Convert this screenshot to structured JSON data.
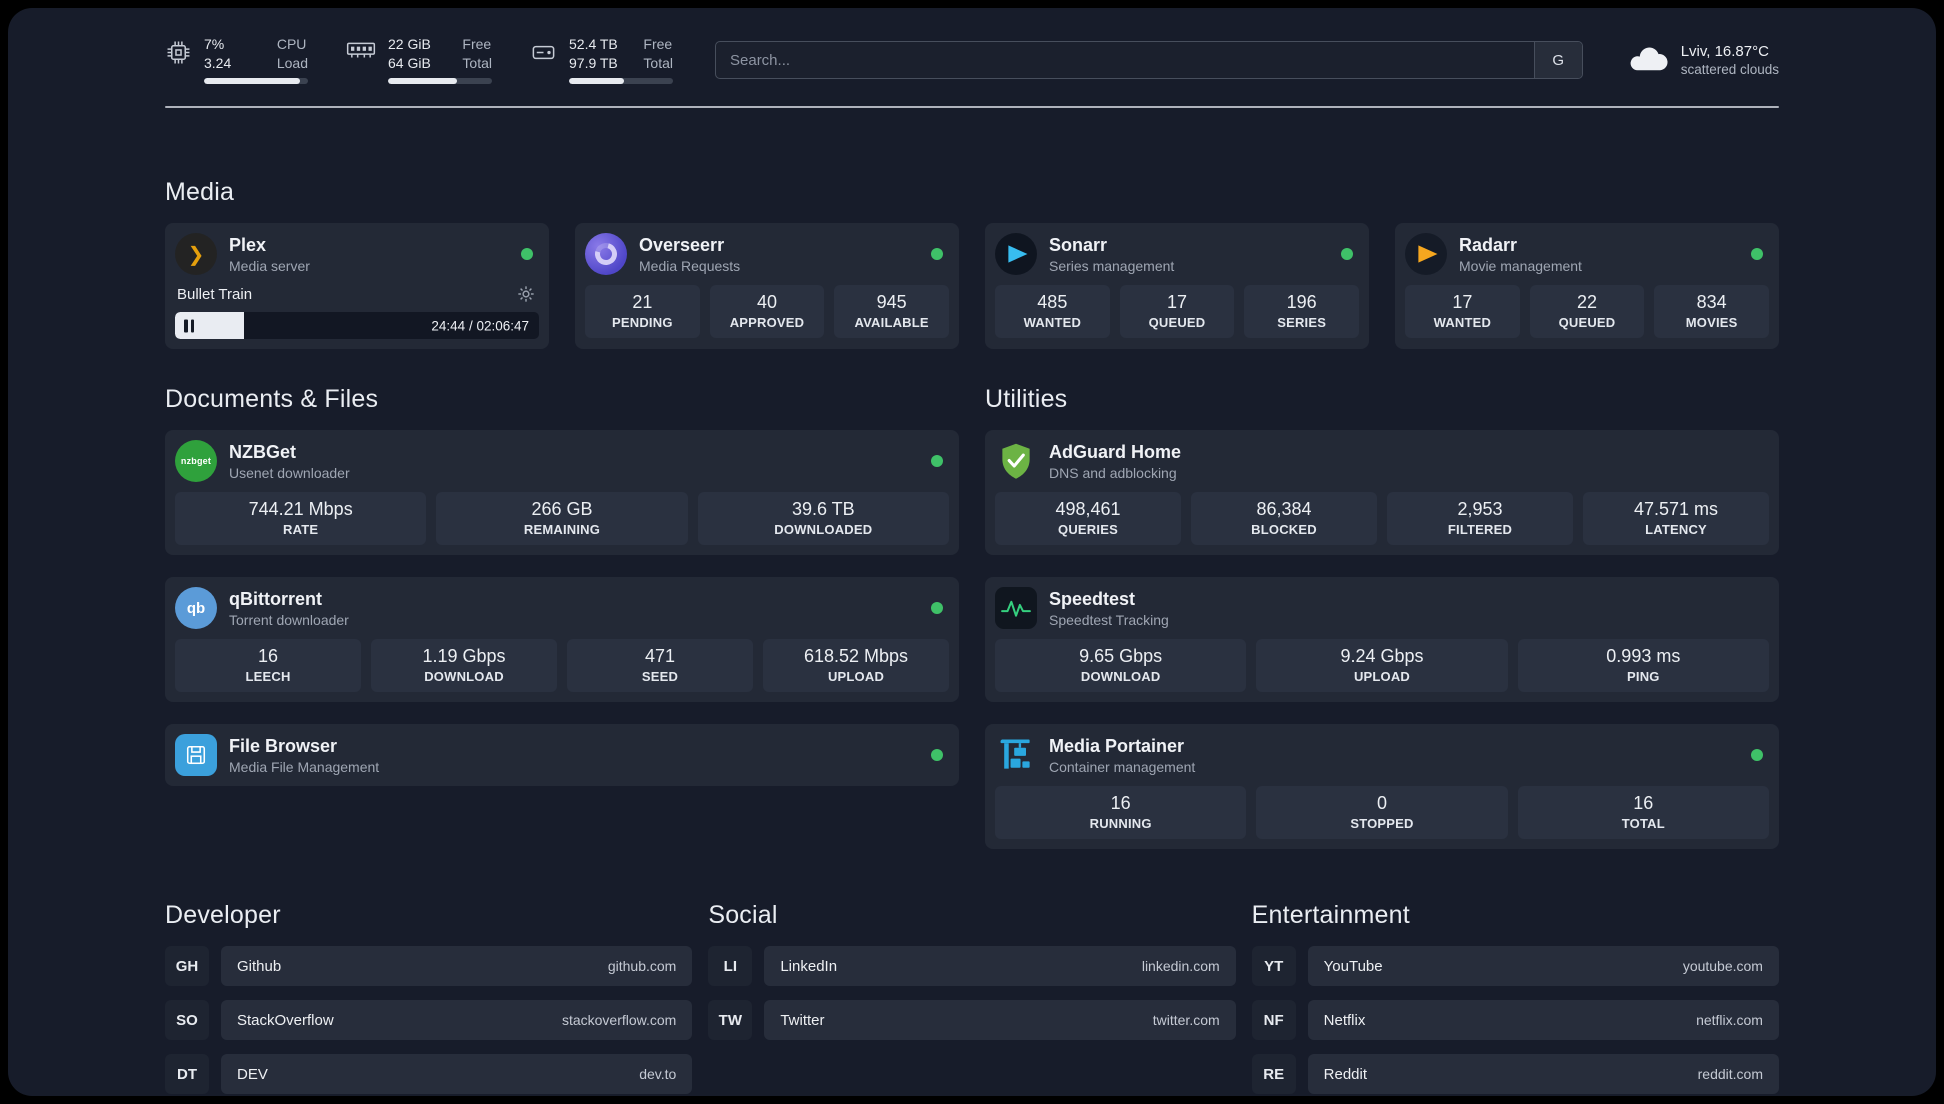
{
  "topbar": {
    "cpu": {
      "values": [
        "7%",
        "3.24"
      ],
      "labels": [
        "CPU",
        "Load"
      ],
      "bar": "92%"
    },
    "ram": {
      "values": [
        "22 GiB",
        "64 GiB"
      ],
      "labels": [
        "Free",
        "Total"
      ],
      "bar": "66%"
    },
    "disk": {
      "values": [
        "52.4 TB",
        "97.9 TB"
      ],
      "labels": [
        "Free",
        "Total"
      ],
      "bar": "53%"
    },
    "search": {
      "placeholder": "Search...",
      "engine_label": "G"
    },
    "weather": {
      "location": "Lviv, 16.87°C",
      "condition": "scattered clouds"
    }
  },
  "sections": {
    "media": "Media",
    "documents": "Documents & Files",
    "utilities": "Utilities",
    "developer": "Developer",
    "social": "Social",
    "entertainment": "Entertainment"
  },
  "apps": {
    "plex": {
      "name": "Plex",
      "desc": "Media server",
      "player_title": "Bullet Train",
      "player_time": "24:44 / 02:06:47",
      "progress": "19%"
    },
    "overseerr": {
      "name": "Overseerr",
      "desc": "Media Requests",
      "stats": [
        {
          "value": "21",
          "label": "PENDING"
        },
        {
          "value": "40",
          "label": "APPROVED"
        },
        {
          "value": "945",
          "label": "AVAILABLE"
        }
      ]
    },
    "sonarr": {
      "name": "Sonarr",
      "desc": "Series management",
      "stats": [
        {
          "value": "485",
          "label": "WANTED"
        },
        {
          "value": "17",
          "label": "QUEUED"
        },
        {
          "value": "196",
          "label": "SERIES"
        }
      ]
    },
    "radarr": {
      "name": "Radarr",
      "desc": "Movie management",
      "stats": [
        {
          "value": "17",
          "label": "WANTED"
        },
        {
          "value": "22",
          "label": "QUEUED"
        },
        {
          "value": "834",
          "label": "MOVIES"
        }
      ]
    },
    "nzbget": {
      "name": "NZBGet",
      "desc": "Usenet downloader",
      "icon_text": "nzbget",
      "stats": [
        {
          "value": "744.21 Mbps",
          "label": "RATE"
        },
        {
          "value": "266 GB",
          "label": "REMAINING"
        },
        {
          "value": "39.6 TB",
          "label": "DOWNLOADED"
        }
      ]
    },
    "qbittorrent": {
      "name": "qBittorrent",
      "desc": "Torrent downloader",
      "icon_text": "qb",
      "stats": [
        {
          "value": "16",
          "label": "LEECH"
        },
        {
          "value": "1.19 Gbps",
          "label": "DOWNLOAD"
        },
        {
          "value": "471",
          "label": "SEED"
        },
        {
          "value": "618.52 Mbps",
          "label": "UPLOAD"
        }
      ]
    },
    "filebrowser": {
      "name": "File Browser",
      "desc": "Media File Management"
    },
    "adguard": {
      "name": "AdGuard Home",
      "desc": "DNS and adblocking",
      "stats": [
        {
          "value": "498,461",
          "label": "QUERIES"
        },
        {
          "value": "86,384",
          "label": "BLOCKED"
        },
        {
          "value": "2,953",
          "label": "FILTERED"
        },
        {
          "value": "47.571 ms",
          "label": "LATENCY"
        }
      ]
    },
    "speedtest": {
      "name": "Speedtest",
      "desc": "Speedtest Tracking",
      "stats": [
        {
          "value": "9.65 Gbps",
          "label": "DOWNLOAD"
        },
        {
          "value": "9.24 Gbps",
          "label": "UPLOAD"
        },
        {
          "value": "0.993 ms",
          "label": "PING"
        }
      ]
    },
    "portainer": {
      "name": "Media Portainer",
      "desc": "Container management",
      "stats": [
        {
          "value": "16",
          "label": "RUNNING"
        },
        {
          "value": "0",
          "label": "STOPPED"
        },
        {
          "value": "16",
          "label": "TOTAL"
        }
      ]
    }
  },
  "bookmarks": {
    "developer": [
      {
        "abbr": "GH",
        "name": "Github",
        "url": "github.com"
      },
      {
        "abbr": "SO",
        "name": "StackOverflow",
        "url": "stackoverflow.com"
      },
      {
        "abbr": "DT",
        "name": "DEV",
        "url": "dev.to"
      }
    ],
    "social": [
      {
        "abbr": "LI",
        "name": "LinkedIn",
        "url": "linkedin.com"
      },
      {
        "abbr": "TW",
        "name": "Twitter",
        "url": "twitter.com"
      }
    ],
    "entertainment": [
      {
        "abbr": "YT",
        "name": "YouTube",
        "url": "youtube.com"
      },
      {
        "abbr": "NF",
        "name": "Netflix",
        "url": "netflix.com"
      },
      {
        "abbr": "RE",
        "name": "Reddit",
        "url": "reddit.com"
      }
    ]
  },
  "icons": {
    "plex_glyph": "❯"
  },
  "colors": {
    "status_online": "#3fc168",
    "accent_green": "#6cb344",
    "portainer_blue": "#2aa7df"
  }
}
